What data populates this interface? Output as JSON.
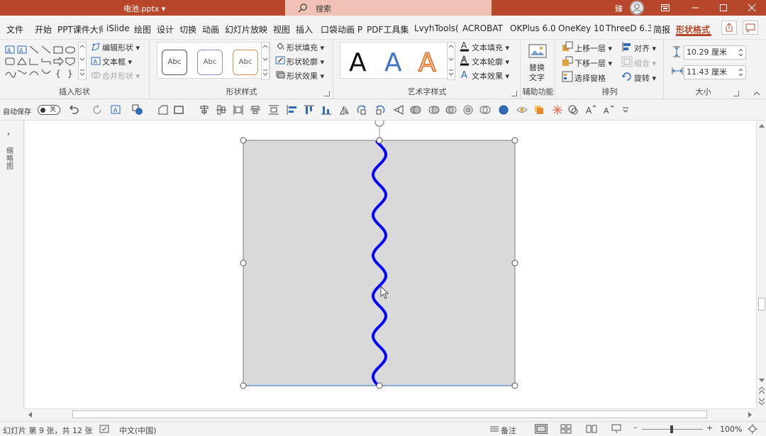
{
  "title_bar": {
    "document": "电池.pptx ▾",
    "search_placeholder": "搜索",
    "user_initial": "臻"
  },
  "tabs": [
    "文件",
    "开始",
    "PPT课件大师",
    "iSlide",
    "绘图",
    "设计",
    "切换",
    "动画",
    "幻灯片放映",
    "视图",
    "插入",
    "口袋动画 P",
    "PDF工具集",
    "LvyhTools(",
    "ACROBAT",
    "OKPlus 6.0",
    "OneKey 10",
    "ThreeD 6.3",
    "简报",
    "形状格式"
  ],
  "active_tab": "形状格式",
  "ribbon": {
    "insert_shapes": {
      "label": "插入形状",
      "edit_shape": "编辑形状 ▾",
      "text_box": "文本框 ▾",
      "merge_shapes": "合并形状 ▾"
    },
    "shape_styles": {
      "label": "形状样式",
      "samples": [
        "Abc",
        "Abc",
        "Abc"
      ],
      "fill": "形状填充 ▾",
      "outline": "形状轮廓 ▾",
      "effect": "形状效果 ▾"
    },
    "wordart": {
      "label": "艺术字样式",
      "samples": [
        "A",
        "A",
        "A"
      ],
      "text_fill": "文本填充 ▾",
      "text_outline": "文本轮廓 ▾",
      "text_effect": "文本效果 ▾"
    },
    "accessibility": {
      "label": "辅助功能",
      "alt_text_line1": "替换",
      "alt_text_line2": "文字"
    },
    "arrange": {
      "label": "排列",
      "bring_forward": "上移一层 ▾",
      "send_backward": "下移一层 ▾",
      "selection_pane": "选择窗格",
      "align": "对齐 ▾",
      "group": "组合 ▾",
      "rotate": "旋转 ▾"
    },
    "size": {
      "label": "大小",
      "height": "10.29 厘米",
      "width": "11.43 厘米"
    }
  },
  "qat": {
    "autosave_label": "自动保存",
    "autosave_state": "关"
  },
  "thumbnail_pane": {
    "label": "缩略图"
  },
  "slide": {
    "shape_fill": "#d9d9d9",
    "shape_border": "#7f7f7f",
    "wave_color": "#0000ff"
  },
  "status_bar": {
    "slide_info": "幻灯片 第 9 张，共 12 张",
    "language": "中文(中国)",
    "notes": "备注",
    "zoom": "100%"
  },
  "colors": {
    "accent": "#b7472a",
    "search_bg": "#f0c2b6"
  }
}
